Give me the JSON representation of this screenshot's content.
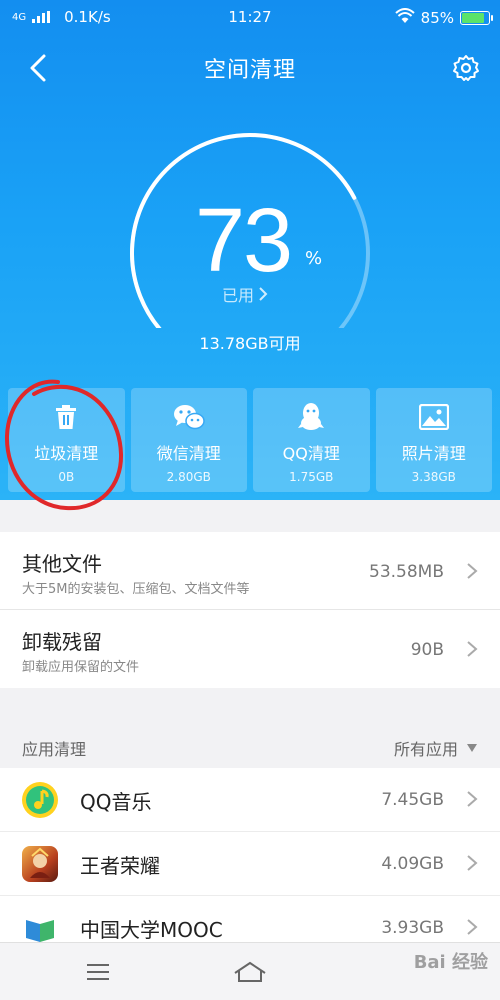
{
  "status_bar": {
    "network": "4G",
    "speed": "0.1K/s",
    "time": "11:27",
    "battery": "85%"
  },
  "header": {
    "title": "空间清理",
    "back_icon": "chevron-left-icon",
    "settings_icon": "gear-icon"
  },
  "storage": {
    "used_percent": "73",
    "percent_unit": "%",
    "used_label": "已用",
    "available": "13.78GB可用",
    "usage_fraction": 0.73
  },
  "categories": [
    {
      "label": "垃圾清理",
      "value": "0B",
      "icon": "trash-icon"
    },
    {
      "label": "微信清理",
      "value": "2.80GB",
      "icon": "wechat-icon"
    },
    {
      "label": "QQ清理",
      "value": "1.75GB",
      "icon": "qq-penguin-icon"
    },
    {
      "label": "照片清理",
      "value": "3.38GB",
      "icon": "photo-icon"
    }
  ],
  "file_rows": [
    {
      "title": "其他文件",
      "subtitle": "大于5M的安装包、压缩包、文档文件等",
      "value": "53.58MB"
    },
    {
      "title": "卸载残留",
      "subtitle": "卸载应用保留的文件",
      "value": "90B"
    }
  ],
  "app_section": {
    "title": "应用清理",
    "filter": "所有应用"
  },
  "apps": [
    {
      "name": "QQ音乐",
      "size": "7.45GB",
      "icon_color": "#31c27c"
    },
    {
      "name": "王者荣耀",
      "size": "4.09GB",
      "icon_color": "#b8401f"
    },
    {
      "name": "中国大学MOOC",
      "size": "3.93GB",
      "icon_color": "#2e8bd8"
    }
  ],
  "watermark": "Bai 经验",
  "colors": {
    "hero_top": "#138ef0",
    "hero_bottom": "#2bb3f7",
    "annotation_red": "#e0282a"
  }
}
